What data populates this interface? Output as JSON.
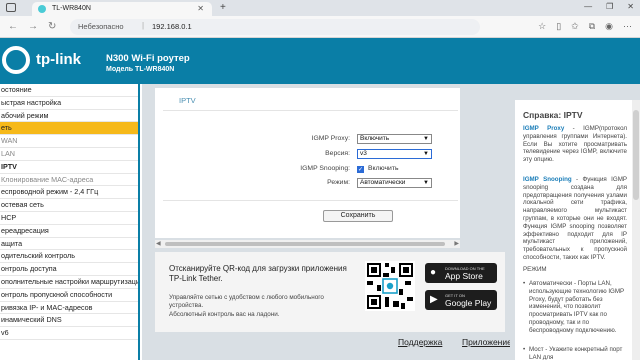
{
  "browser": {
    "tab_title": "TL-WR840N",
    "tab_close": "✕",
    "new_tab": "+",
    "window_controls": [
      "—",
      "❐",
      "✕"
    ],
    "security_label": "Небезопасно",
    "url": "192.168.0.1"
  },
  "header": {
    "logo_text": "tp-link",
    "title": "N300 Wi-Fi роутер",
    "subtitle": "Модель TL-WR840N",
    "color": "#0a7ea6"
  },
  "menu": {
    "items": [
      {
        "label": "остояние",
        "state": "normal"
      },
      {
        "label": "ыстрая настройка",
        "state": "normal"
      },
      {
        "label": "абочий режим",
        "state": "normal"
      },
      {
        "label": "еть",
        "state": "active"
      },
      {
        "label": "WAN",
        "state": "sub"
      },
      {
        "label": "LAN",
        "state": "sub"
      },
      {
        "label": "IPTV",
        "state": "sub-bold"
      },
      {
        "label": "Клонирование MAC-адреса",
        "state": "sub"
      },
      {
        "label": "еспроводной режим - 2,4 ГГц",
        "state": "normal"
      },
      {
        "label": "остевая сеть",
        "state": "normal"
      },
      {
        "label": "HCP",
        "state": "normal"
      },
      {
        "label": "ереадресация",
        "state": "normal"
      },
      {
        "label": "ащита",
        "state": "normal"
      },
      {
        "label": "одительский контроль",
        "state": "normal"
      },
      {
        "label": "онтроль доступа",
        "state": "normal"
      },
      {
        "label": "ополнительные настройки маршрутизации",
        "state": "normal"
      },
      {
        "label": "онтроль пропускной способности",
        "state": "normal"
      },
      {
        "label": "ривязка IP- и MAC-адресов",
        "state": "normal"
      },
      {
        "label": "инамический DNS",
        "state": "normal"
      },
      {
        "label": "v6",
        "state": "normal"
      }
    ],
    "active_color": "#f6b91a"
  },
  "iptv": {
    "title": "IPTV",
    "igmp_proxy_label": "IGMP Proxy:",
    "igmp_proxy_value": "Включить",
    "version_label": "Версия:",
    "version_value": "v3",
    "snooping_label": "IGMP Snooping:",
    "snooping_checked": true,
    "snooping_text": "Включить",
    "mode_label": "Режим:",
    "mode_value": "Автоматически",
    "save_label": "Сохранить"
  },
  "promo": {
    "title": "Отсканируйте QR-код для загрузки приложения TP-Link Tether.",
    "description": "Управляйте сетью с удобством с любого мобильного устройства.",
    "slogan": "Абсолютный контроль вас на ладони.",
    "app_store_small": "DOWNLOAD ON THE",
    "app_store_big": "App Store",
    "play_small": "GET IT ON",
    "play_big": "Google Play"
  },
  "footer": {
    "support": "Поддержка",
    "app": "Приложение"
  },
  "help": {
    "title": "Справка: IPTV",
    "proxy_term": "IGMP Proxy",
    "proxy_text": " - IGMP(протокол управления группами Интернета). Если Вы хотите просматривать телевидение через IGMP, включите эту опцию.",
    "snooping_term": "IGMP Snooping",
    "snooping_text": " - Функция IGMP snooping создана для предотвращения получения узлами локальной сети трафика, направляемого мультикаст группам, в которые они не входят. Функция IGMP snooping позволяет эффективно подходит для IP мультикаст приложений, требовательных к пропускной способности, таких как IPTV.",
    "mode_heading": "РЕЖИМ",
    "bullet1": "Автоматически - Порты LAN, использующие технологию IGMP Proxy, будут работать без изменений, что позволит просматривать IPTV как по проводному, так и по беспроводному подключению.",
    "bullet2": "Мост - Укажите конкретный порт LAN для"
  }
}
